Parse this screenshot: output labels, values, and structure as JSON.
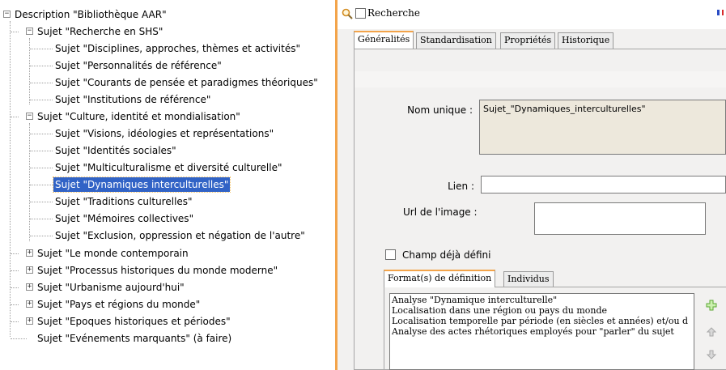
{
  "tree": {
    "nodes": [
      {
        "label": "Description \"Bibliothèque AAR\"",
        "level": 0,
        "expander": "minus",
        "selected": false
      },
      {
        "label": "Sujet \"Recherche en SHS\"",
        "level": 1,
        "expander": "minus",
        "selected": false
      },
      {
        "label": "Sujet \"Disciplines, approches, thèmes et activités\"",
        "level": 2,
        "expander": "none",
        "selected": false
      },
      {
        "label": "Sujet \"Personnalités de référence\"",
        "level": 2,
        "expander": "none",
        "selected": false
      },
      {
        "label": "Sujet \"Courants de pensée et paradigmes théoriques\"",
        "level": 2,
        "expander": "none",
        "selected": false
      },
      {
        "label": "Sujet \"Institutions de référence\"",
        "level": 2,
        "expander": "none",
        "selected": false
      },
      {
        "label": "Sujet \"Culture, identité et mondialisation\"",
        "level": 1,
        "expander": "minus",
        "selected": false
      },
      {
        "label": "Sujet \"Visions, idéologies et représentations\"",
        "level": 2,
        "expander": "none",
        "selected": false
      },
      {
        "label": "Sujet \"Identités sociales\"",
        "level": 2,
        "expander": "none",
        "selected": false
      },
      {
        "label": "Sujet \"Multiculturalisme et diversité culturelle\"",
        "level": 2,
        "expander": "none",
        "selected": false
      },
      {
        "label": "Sujet \"Dynamiques interculturelles\"",
        "level": 2,
        "expander": "none",
        "selected": true
      },
      {
        "label": "Sujet \"Traditions culturelles\"",
        "level": 2,
        "expander": "none",
        "selected": false
      },
      {
        "label": "Sujet \"Mémoires collectives\"",
        "level": 2,
        "expander": "none",
        "selected": false
      },
      {
        "label": "Sujet \"Exclusion, oppression et négation de l'autre\"",
        "level": 2,
        "expander": "none",
        "selected": false
      },
      {
        "label": "Sujet \"Le monde contemporain",
        "level": 1,
        "expander": "plus",
        "selected": false
      },
      {
        "label": "Sujet \"Processus historiques du monde moderne\"",
        "level": 1,
        "expander": "plus",
        "selected": false
      },
      {
        "label": "Sujet \"Urbanisme aujourd'hui\"",
        "level": 1,
        "expander": "plus",
        "selected": false
      },
      {
        "label": "Sujet \"Pays et régions du monde\"",
        "level": 1,
        "expander": "plus",
        "selected": false
      },
      {
        "label": "Sujet \"Epoques historiques et périodes\"",
        "level": 1,
        "expander": "plus",
        "selected": false
      },
      {
        "label": "Sujet \"Evénements marquants\" (à faire)",
        "level": 1,
        "expander": "none",
        "selected": false
      }
    ]
  },
  "search": {
    "label": "Recherche",
    "checked": false
  },
  "tabs": [
    {
      "label": "Généralités",
      "active": true
    },
    {
      "label": "Standardisation",
      "active": false
    },
    {
      "label": "Propriétés",
      "active": false
    },
    {
      "label": "Historique",
      "active": false
    }
  ],
  "form": {
    "nom_unique_label": "Nom unique :",
    "nom_unique_value": "Sujet_\"Dynamiques_interculturelles\"",
    "lien_label": "Lien :",
    "lien_value": "",
    "url_image_label": "Url de l'image :",
    "url_image_value": "",
    "champ_label": "Champ déjà défini",
    "champ_checked": false
  },
  "subtabs": [
    {
      "label": "Format(s) de définition",
      "active": true
    },
    {
      "label": "Individus",
      "active": false
    }
  ],
  "definitions": [
    "Analyse \"Dynamique interculturelle\"",
    "Localisation dans une région ou pays du monde",
    "Localisation temporelle par période (en siècles et années) et/ou d",
    "Analyse des actes rhétoriques employés pour \"parler\" du sujet"
  ],
  "side_actions": [
    {
      "icon": "plus-icon",
      "enabled": true
    },
    {
      "icon": "up-arrow-icon",
      "enabled": false
    },
    {
      "icon": "down-arrow-icon",
      "enabled": false
    }
  ],
  "colors": {
    "accent": "#f3a44a",
    "selection": "#3163c6",
    "panel_bg": "#f2f1f0",
    "readonly_field": "#ede8dc",
    "add_icon": "#5aa832"
  }
}
